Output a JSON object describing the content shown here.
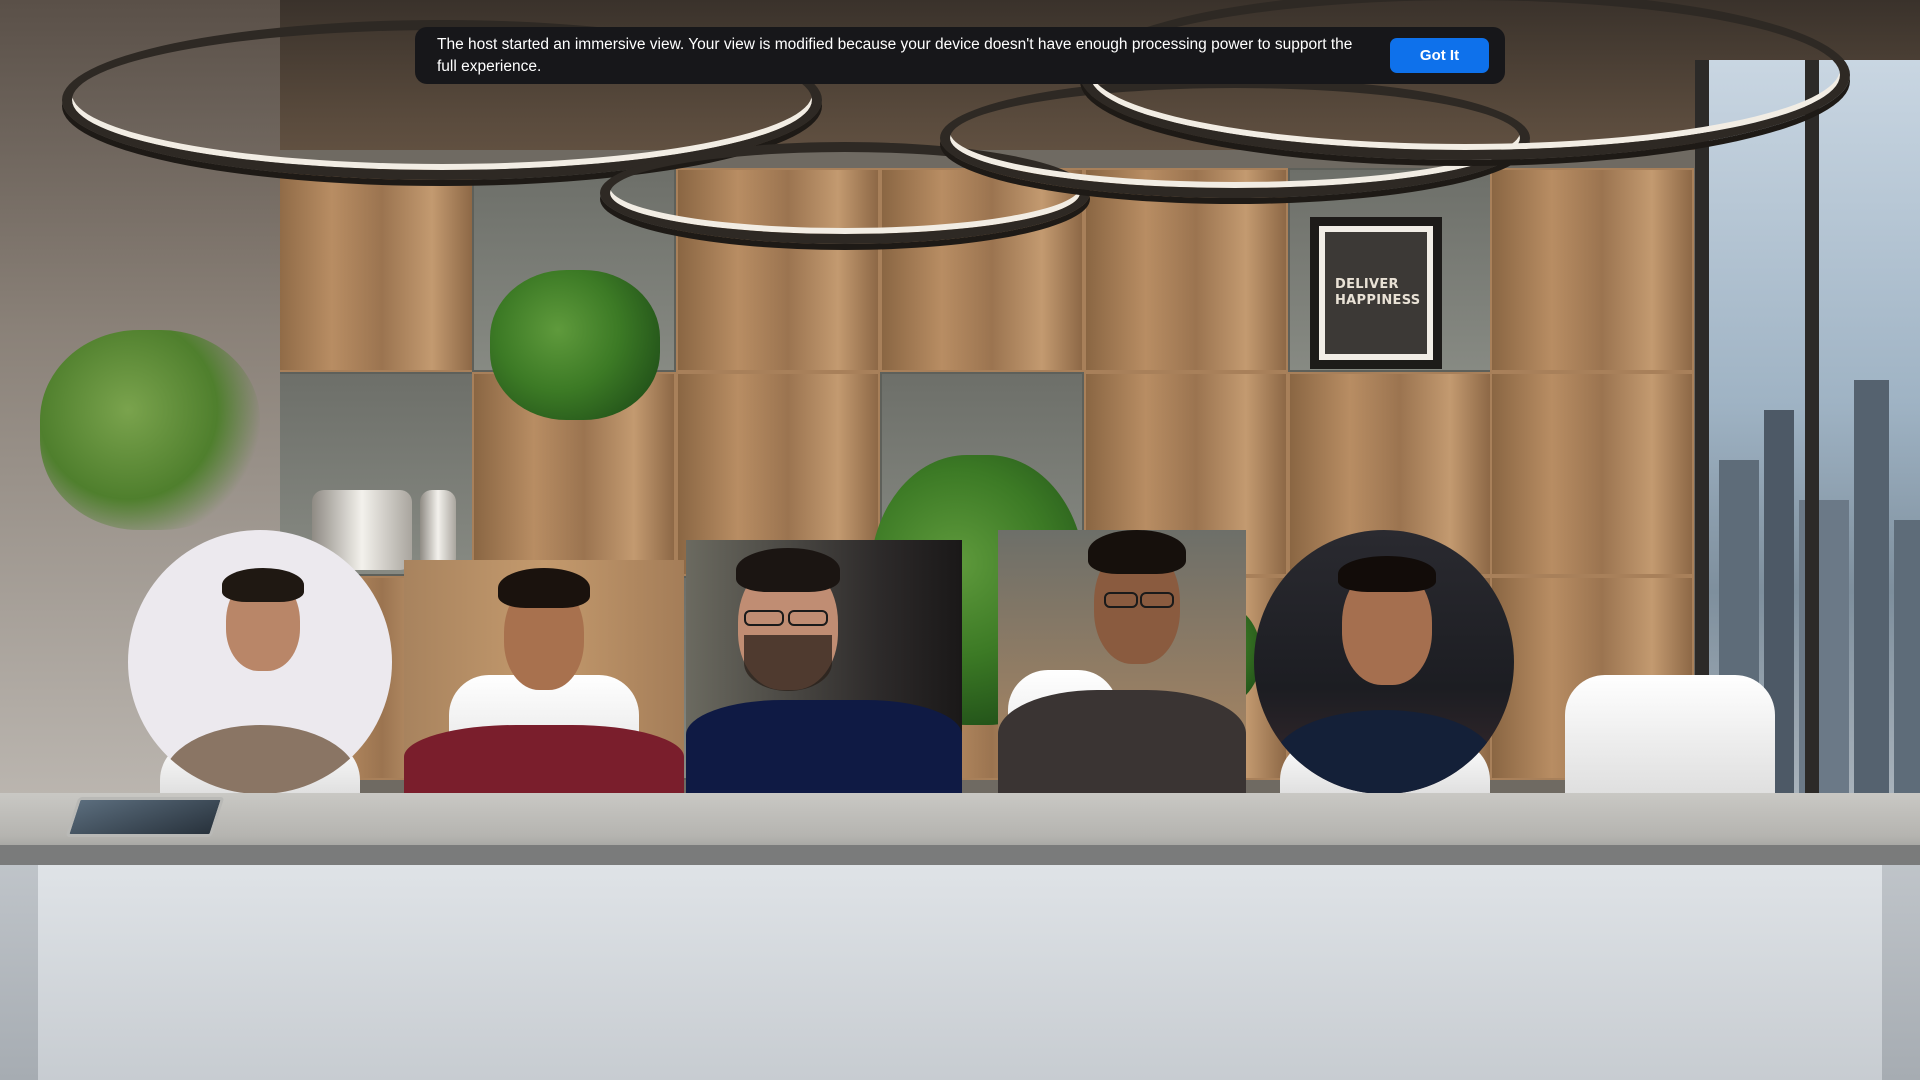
{
  "notification": {
    "message": "The host started an immersive view. Your view is modified because your device doesn't have enough processing power to support the full experience.",
    "button_label": "Got It",
    "background_color": "#17171a",
    "button_color": "#0e71eb"
  },
  "scene": {
    "poster_lines": [
      "DELIVER",
      "HAPPINESS"
    ]
  },
  "participants": [
    {
      "shape": "circle",
      "background": "#ece9ee",
      "shirt_color": "#8a7564"
    },
    {
      "shape": "rectangle",
      "background": "#b6936d",
      "shirt_color": "#7a1e2c"
    },
    {
      "shape": "rectangle",
      "background": "#2d2a2a",
      "shirt_color": "#0f1a44"
    },
    {
      "shape": "rectangle",
      "background": "#6d6f69",
      "shirt_color": "#3a3433"
    },
    {
      "shape": "circle",
      "background": "#1c1d22",
      "shirt_color": "#142038"
    }
  ]
}
